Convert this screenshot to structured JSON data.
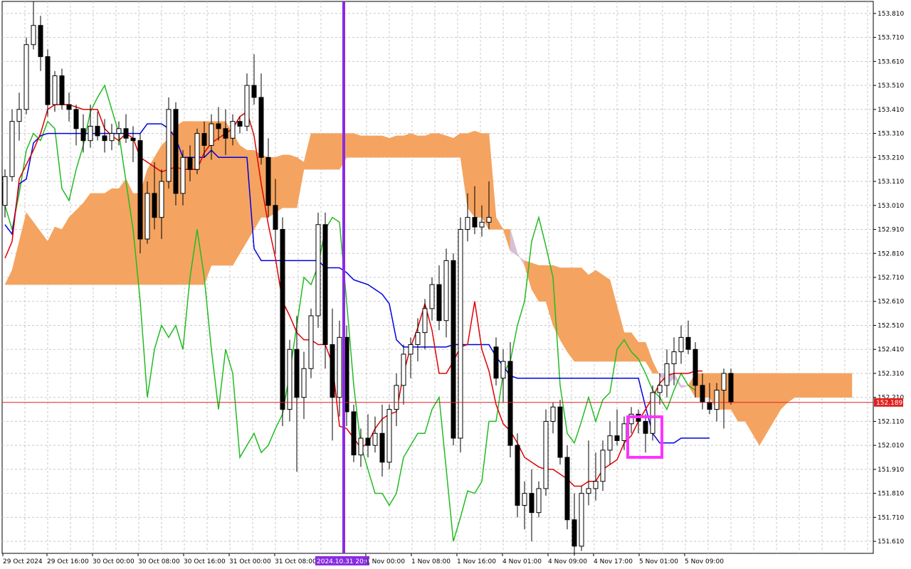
{
  "chart_data": {
    "type": "candlestick",
    "indicator": "ichimoku",
    "grid": true,
    "ylim": [
      151.56,
      153.86
    ],
    "y_ticks": [
      "153.810",
      "153.710",
      "153.610",
      "153.510",
      "153.410",
      "153.310",
      "153.210",
      "153.110",
      "153.010",
      "152.910",
      "152.810",
      "152.710",
      "152.610",
      "152.510",
      "152.410",
      "152.310",
      "152.210",
      "152.110",
      "152.010",
      "151.910",
      "151.810",
      "151.710",
      "151.610"
    ],
    "x_labels": [
      "29 Oct 2024",
      "29 Oct 16:00",
      "30 Oct 00:00",
      "30 Oct 08:00",
      "30 Oct 16:00",
      "31 Oct 00:00",
      "31 Oct 08:00",
      "2024.10.31 20:00",
      "1 Nov 00:00",
      "1 Nov 08:00",
      "1 Nov 16:00",
      "4 Nov 01:00",
      "4 Nov 09:00",
      "4 Nov 17:00",
      "5 Nov 01:00",
      "5 Nov 09:00"
    ],
    "current_price": "152.189",
    "vline_label": "2024.10.31 20:00",
    "colors": {
      "bull_candle": "#ffffff",
      "bear_candle": "#000000",
      "tenkan": "#e00000",
      "kijun": "#0000e0",
      "chikou": "#22bb22",
      "cloud_bull": "#f4a460",
      "cloud_bear": "#d8bfd8",
      "price_line": "#e02020",
      "vline": "#8a2be2",
      "highlight_box": "#ff33ff",
      "span_a": "#ff69b4",
      "span_b": "#006060"
    },
    "candles": [
      [
        153.01,
        153.16,
        152.96,
        153.13
      ],
      [
        153.13,
        153.41,
        153.11,
        153.36
      ],
      [
        153.36,
        153.48,
        153.28,
        153.41
      ],
      [
        153.41,
        153.71,
        153.39,
        153.68
      ],
      [
        153.68,
        153.86,
        153.66,
        153.76
      ],
      [
        153.76,
        153.8,
        153.57,
        153.63
      ],
      [
        153.63,
        153.66,
        153.38,
        153.43
      ],
      [
        153.43,
        153.57,
        153.4,
        153.55
      ],
      [
        153.55,
        153.58,
        153.41,
        153.43
      ],
      [
        153.43,
        153.48,
        153.36,
        153.41
      ],
      [
        153.41,
        153.43,
        153.26,
        153.33
      ],
      [
        153.33,
        153.39,
        153.23,
        153.28
      ],
      [
        153.28,
        153.43,
        153.25,
        153.34
      ],
      [
        153.34,
        153.4,
        153.28,
        153.3
      ],
      [
        153.3,
        153.37,
        153.23,
        153.28
      ],
      [
        153.28,
        153.35,
        153.24,
        153.31
      ],
      [
        153.31,
        153.36,
        153.26,
        153.33
      ],
      [
        153.33,
        153.39,
        153.27,
        153.29
      ],
      [
        153.29,
        153.34,
        153.19,
        153.28
      ],
      [
        153.28,
        153.31,
        152.81,
        152.87
      ],
      [
        152.87,
        153.11,
        152.85,
        153.06
      ],
      [
        153.06,
        153.19,
        152.91,
        152.96
      ],
      [
        152.96,
        153.16,
        152.87,
        153.11
      ],
      [
        153.11,
        153.46,
        153.08,
        153.41
      ],
      [
        153.41,
        153.44,
        153.01,
        153.06
      ],
      [
        153.06,
        153.24,
        153.01,
        153.21
      ],
      [
        153.21,
        153.26,
        153.11,
        153.16
      ],
      [
        153.16,
        153.33,
        153.14,
        153.31
      ],
      [
        153.31,
        153.36,
        153.21,
        153.26
      ],
      [
        153.26,
        153.39,
        153.2,
        153.35
      ],
      [
        153.35,
        153.42,
        153.28,
        153.33
      ],
      [
        153.33,
        153.41,
        153.22,
        153.29
      ],
      [
        153.29,
        153.39,
        153.26,
        153.36
      ],
      [
        153.36,
        153.38,
        153.31,
        153.34
      ],
      [
        153.34,
        153.56,
        153.32,
        153.51
      ],
      [
        153.51,
        153.64,
        153.43,
        153.46
      ],
      [
        153.46,
        153.56,
        153.18,
        153.21
      ],
      [
        153.21,
        153.29,
        152.96,
        153.01
      ],
      [
        153.01,
        153.12,
        152.81,
        152.91
      ],
      [
        152.91,
        152.96,
        152.09,
        152.16
      ],
      [
        152.16,
        152.45,
        152.11,
        152.41
      ],
      [
        152.41,
        152.55,
        151.9,
        152.21
      ],
      [
        152.21,
        152.4,
        152.12,
        152.33
      ],
      [
        152.33,
        152.58,
        152.29,
        152.55
      ],
      [
        152.55,
        152.98,
        152.5,
        152.93
      ],
      [
        152.93,
        152.98,
        152.33,
        152.43
      ],
      [
        152.43,
        152.58,
        152.03,
        152.21
      ],
      [
        152.21,
        152.53,
        152.13,
        152.46
      ],
      [
        152.46,
        152.51,
        152.09,
        152.15
      ],
      [
        152.15,
        152.18,
        151.94,
        151.97
      ],
      [
        151.97,
        152.08,
        151.92,
        152.04
      ],
      [
        152.04,
        152.14,
        151.96,
        152.01
      ],
      [
        152.01,
        152.13,
        151.98,
        152.06
      ],
      [
        152.06,
        152.18,
        151.88,
        151.94
      ],
      [
        151.94,
        152.18,
        151.91,
        152.16
      ],
      [
        152.16,
        152.31,
        152.09,
        152.26
      ],
      [
        152.26,
        152.43,
        152.18,
        152.39
      ],
      [
        152.39,
        152.46,
        152.29,
        152.43
      ],
      [
        152.43,
        152.54,
        152.36,
        152.48
      ],
      [
        152.48,
        152.62,
        152.41,
        152.58
      ],
      [
        152.58,
        152.71,
        152.53,
        152.68
      ],
      [
        152.68,
        152.76,
        152.49,
        152.53
      ],
      [
        152.53,
        152.83,
        152.46,
        152.78
      ],
      [
        152.78,
        152.81,
        152.01,
        152.04
      ],
      [
        152.04,
        152.96,
        151.98,
        152.91
      ],
      [
        152.91,
        153.06,
        152.86,
        152.96
      ],
      [
        152.96,
        153.09,
        152.89,
        152.92
      ],
      [
        152.92,
        153.01,
        152.88,
        152.94
      ],
      [
        152.94,
        153.11,
        152.91,
        152.96
      ],
      [
        152.42,
        152.46,
        152.26,
        152.29
      ],
      [
        152.29,
        152.41,
        152.19,
        152.36
      ],
      [
        152.36,
        152.44,
        151.96,
        152.01
      ],
      [
        152.01,
        152.06,
        151.71,
        151.76
      ],
      [
        151.76,
        151.86,
        151.66,
        151.81
      ],
      [
        151.81,
        151.91,
        151.61,
        151.73
      ],
      [
        151.73,
        151.86,
        151.71,
        151.83
      ],
      [
        151.83,
        152.16,
        151.8,
        152.11
      ],
      [
        152.11,
        152.19,
        152.06,
        152.17
      ],
      [
        152.17,
        152.2,
        151.93,
        151.96
      ],
      [
        151.96,
        152.01,
        151.66,
        151.7
      ],
      [
        151.7,
        151.81,
        151.55,
        151.59
      ],
      [
        151.59,
        151.84,
        151.57,
        151.81
      ],
      [
        151.81,
        152.03,
        151.76,
        151.83
      ],
      [
        151.83,
        151.98,
        151.78,
        151.86
      ],
      [
        151.86,
        152.03,
        151.82,
        151.99
      ],
      [
        151.99,
        152.11,
        151.93,
        152.05
      ],
      [
        152.05,
        152.16,
        152.01,
        152.03
      ],
      [
        152.03,
        152.13,
        151.99,
        152.1
      ],
      [
        152.1,
        152.17,
        152.06,
        152.14
      ],
      [
        152.14,
        152.16,
        152.06,
        152.11
      ],
      [
        152.11,
        152.14,
        151.98,
        152.06
      ],
      [
        152.06,
        152.26,
        152.03,
        152.23
      ],
      [
        152.23,
        152.31,
        152.18,
        152.26
      ],
      [
        152.26,
        152.41,
        152.21,
        152.35
      ],
      [
        152.35,
        152.46,
        152.26,
        152.4
      ],
      [
        152.4,
        152.51,
        152.35,
        152.46
      ],
      [
        152.46,
        152.53,
        152.39,
        152.41
      ],
      [
        152.41,
        152.44,
        152.21,
        152.26
      ],
      [
        152.26,
        152.31,
        152.16,
        152.19
      ],
      [
        152.19,
        152.27,
        152.14,
        152.16
      ],
      [
        152.16,
        152.27,
        152.11,
        152.24
      ],
      [
        152.24,
        152.33,
        152.08,
        152.31
      ],
      [
        152.31,
        152.33,
        152.18,
        152.19
      ]
    ],
    "tenkan": [
      152.79,
      152.86,
      153.12,
      153.18,
      153.24,
      153.31,
      153.41,
      153.43,
      153.43,
      153.43,
      153.42,
      153.41,
      153.41,
      153.41,
      153.33,
      153.3,
      153.28,
      153.31,
      153.29,
      153.21,
      153.19,
      153.17,
      153.15,
      153.16,
      153.17,
      153.16,
      153.16,
      153.16,
      153.23,
      153.27,
      153.29,
      153.31,
      153.33,
      153.38,
      153.4,
      153.3,
      153.1,
      152.93,
      152.79,
      152.61,
      152.55,
      152.48,
      152.45,
      152.45,
      152.43,
      152.43,
      152.35,
      152.09,
      152.08,
      152.04,
      152.0,
      152.02,
      152.08,
      152.12,
      152.14,
      152.15,
      152.31,
      152.42,
      152.5,
      152.6,
      152.49,
      152.31,
      152.31,
      152.36,
      152.42,
      152.43,
      152.61,
      152.41,
      152.32,
      152.18,
      152.1,
      152.07,
      152.02,
      151.96,
      151.94,
      151.92,
      151.91,
      151.91,
      151.89,
      151.87,
      151.84,
      151.84,
      151.86,
      151.86,
      151.91,
      151.93,
      151.95,
      152.02,
      152.05,
      152.11,
      152.16,
      152.21,
      152.27,
      152.3,
      152.31,
      152.31,
      152.31,
      152.32,
      152.32
    ],
    "kijun": [
      152.93,
      152.89,
      153.1,
      153.12,
      153.27,
      153.3,
      153.31,
      153.31,
      153.31,
      153.31,
      153.31,
      153.31,
      153.31,
      153.31,
      153.31,
      153.31,
      153.31,
      153.31,
      153.31,
      153.31,
      153.35,
      153.35,
      153.35,
      153.33,
      153.29,
      153.21,
      153.21,
      153.21,
      153.21,
      153.24,
      153.21,
      153.21,
      153.21,
      153.21,
      153.21,
      152.83,
      152.78,
      152.78,
      152.78,
      152.78,
      152.78,
      152.78,
      152.78,
      152.78,
      152.78,
      152.75,
      152.75,
      152.75,
      152.73,
      152.7,
      152.69,
      152.68,
      152.66,
      152.64,
      152.6,
      152.45,
      152.42,
      152.42,
      152.42,
      152.42,
      152.42,
      152.42,
      152.42,
      152.43,
      152.43,
      152.43,
      152.43,
      152.43,
      152.43,
      152.38,
      152.34,
      152.3,
      152.29,
      152.29,
      152.29,
      152.29,
      152.29,
      152.29,
      152.29,
      152.29,
      152.29,
      152.29,
      152.29,
      152.29,
      152.29,
      152.29,
      152.29,
      152.29,
      152.29,
      152.29,
      152.17,
      152.06,
      152.02,
      152.02,
      152.02,
      152.04,
      152.04,
      152.04,
      152.04,
      152.04
    ],
    "chikou": [
      153.01,
      152.91,
      153.06,
      153.24,
      153.31,
      153.28,
      153.36,
      153.33,
      153.08,
      153.03,
      153.16,
      153.26,
      153.4,
      153.46,
      153.51,
      153.41,
      153.31,
      153.11,
      152.91,
      152.61,
      152.21,
      152.41,
      152.51,
      152.46,
      152.51,
      152.41,
      152.71,
      152.91,
      152.71,
      152.41,
      152.16,
      152.41,
      152.31,
      151.96,
      152.01,
      152.06,
      151.98,
      152.01,
      152.08,
      152.14,
      152.31,
      152.51,
      152.71,
      152.68,
      152.76,
      152.91,
      152.96,
      152.94,
      152.61,
      152.26,
      152.01,
      151.91,
      151.81,
      151.81,
      151.76,
      151.81,
      151.96,
      152.01,
      152.06,
      152.06,
      152.16,
      152.21,
      151.91,
      151.61,
      151.71,
      151.82,
      151.81,
      151.86,
      152.11,
      152.11,
      152.31,
      152.36,
      152.51,
      152.61,
      152.86,
      152.96,
      152.84,
      152.71,
      152.26,
      152.06,
      152.02,
      152.11,
      152.21,
      152.11,
      152.2,
      152.23,
      152.41,
      152.45,
      152.4,
      152.37,
      152.31,
      152.24,
      152.21,
      152.16,
      152.24,
      152.31,
      152.26,
      152.24
    ],
    "cloud_a": [
      152.68,
      152.74,
      152.86,
      152.98,
      152.94,
      152.9,
      152.86,
      152.92,
      152.91,
      152.96,
      152.99,
      153.02,
      153.06,
      153.06,
      153.06,
      153.08,
      153.08,
      153.12,
      153.06,
      153.06,
      153.16,
      153.21,
      153.26,
      153.29,
      153.34,
      153.36,
      153.36,
      153.36,
      153.36,
      153.36,
      153.36,
      153.36,
      153.31,
      153.26,
      153.24,
      153.24,
      153.22,
      153.21,
      153.21,
      153.22,
      153.22,
      153.21,
      153.19,
      153.31,
      153.31,
      153.31,
      153.31,
      153.31,
      153.31,
      153.31,
      153.3,
      153.3,
      153.3,
      153.3,
      153.29,
      153.3,
      153.3,
      153.31,
      153.3,
      153.3,
      153.31,
      153.31,
      153.3,
      153.29,
      153.31,
      153.31,
      153.32,
      153.31,
      153.31,
      152.96,
      152.91,
      152.82,
      152.8,
      152.78,
      152.77,
      152.76,
      152.76,
      152.76,
      152.75,
      152.75,
      152.75,
      152.75,
      152.72,
      152.74,
      152.72,
      152.7,
      152.59,
      152.48,
      152.48,
      152.44,
      152.44,
      152.36,
      152.3,
      152.26,
      152.29,
      152.25,
      152.26,
      152.31,
      152.31,
      152.31,
      152.31,
      152.31,
      152.31,
      152.31,
      152.31,
      152.31,
      152.31,
      152.31,
      152.31,
      152.31,
      152.31,
      152.31,
      152.31,
      152.31,
      152.31,
      152.31,
      152.31,
      152.31,
      152.31,
      152.31
    ],
    "cloud_b": [
      152.68,
      152.68,
      152.68,
      152.68,
      152.68,
      152.68,
      152.68,
      152.68,
      152.68,
      152.68,
      152.68,
      152.68,
      152.68,
      152.68,
      152.68,
      152.68,
      152.68,
      152.68,
      152.68,
      152.68,
      152.68,
      152.68,
      152.68,
      152.68,
      152.68,
      152.68,
      152.68,
      152.68,
      152.68,
      152.76,
      152.76,
      152.76,
      152.76,
      152.81,
      152.86,
      152.91,
      152.96,
      152.96,
      152.98,
      153.0,
      153.0,
      153.0,
      153.16,
      153.16,
      153.16,
      153.16,
      153.16,
      153.16,
      153.21,
      153.21,
      153.21,
      153.21,
      153.21,
      153.21,
      153.21,
      153.21,
      153.21,
      153.21,
      153.21,
      153.21,
      153.21,
      153.21,
      153.21,
      153.21,
      153.21,
      153.0,
      152.96,
      152.96,
      152.91,
      152.91,
      152.91,
      152.91,
      152.81,
      152.76,
      152.66,
      152.61,
      152.61,
      152.51,
      152.45,
      152.4,
      152.36,
      152.36,
      152.36,
      152.36,
      152.36,
      152.36,
      152.36,
      152.36,
      152.36,
      152.36,
      152.36,
      152.31,
      152.31,
      152.31,
      152.31,
      152.26,
      152.26,
      152.21,
      152.21,
      152.21,
      152.16,
      152.16,
      152.16,
      152.11,
      152.11,
      152.06,
      152.01,
      152.06,
      152.11,
      152.16,
      152.19,
      152.21,
      152.21,
      152.21,
      152.21,
      152.21,
      152.21,
      152.21,
      152.21,
      152.21
    ]
  }
}
